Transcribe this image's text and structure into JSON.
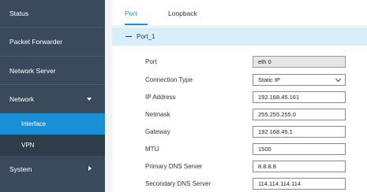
{
  "sidebar": {
    "items": [
      {
        "label": "Status"
      },
      {
        "label": "Packet Forwarder"
      },
      {
        "label": "Network Server"
      },
      {
        "label": "Network"
      },
      {
        "label": "Interface"
      },
      {
        "label": "VPN"
      },
      {
        "label": "System"
      }
    ]
  },
  "tabs": {
    "port": "Port",
    "loopback": "Loopback"
  },
  "panel": {
    "title": "Port_1"
  },
  "form": {
    "port": {
      "label": "Port",
      "value": "eth 0"
    },
    "connection_type": {
      "label": "Connection Type",
      "value": "Static IP"
    },
    "ip_address": {
      "label": "IP Address",
      "value": "192.168.45.161"
    },
    "netmask": {
      "label": "Netmask",
      "value": "255.255.255.0"
    },
    "gateway": {
      "label": "Gateway",
      "value": "192.168.45.1"
    },
    "mtu": {
      "label": "MTU",
      "value": "1500"
    },
    "primary_dns": {
      "label": "Primary DNS Server",
      "value": "8.8.8.8"
    },
    "secondary_dns": {
      "label": "Secondary DNS Server",
      "value": "114.114.114.114"
    }
  }
}
